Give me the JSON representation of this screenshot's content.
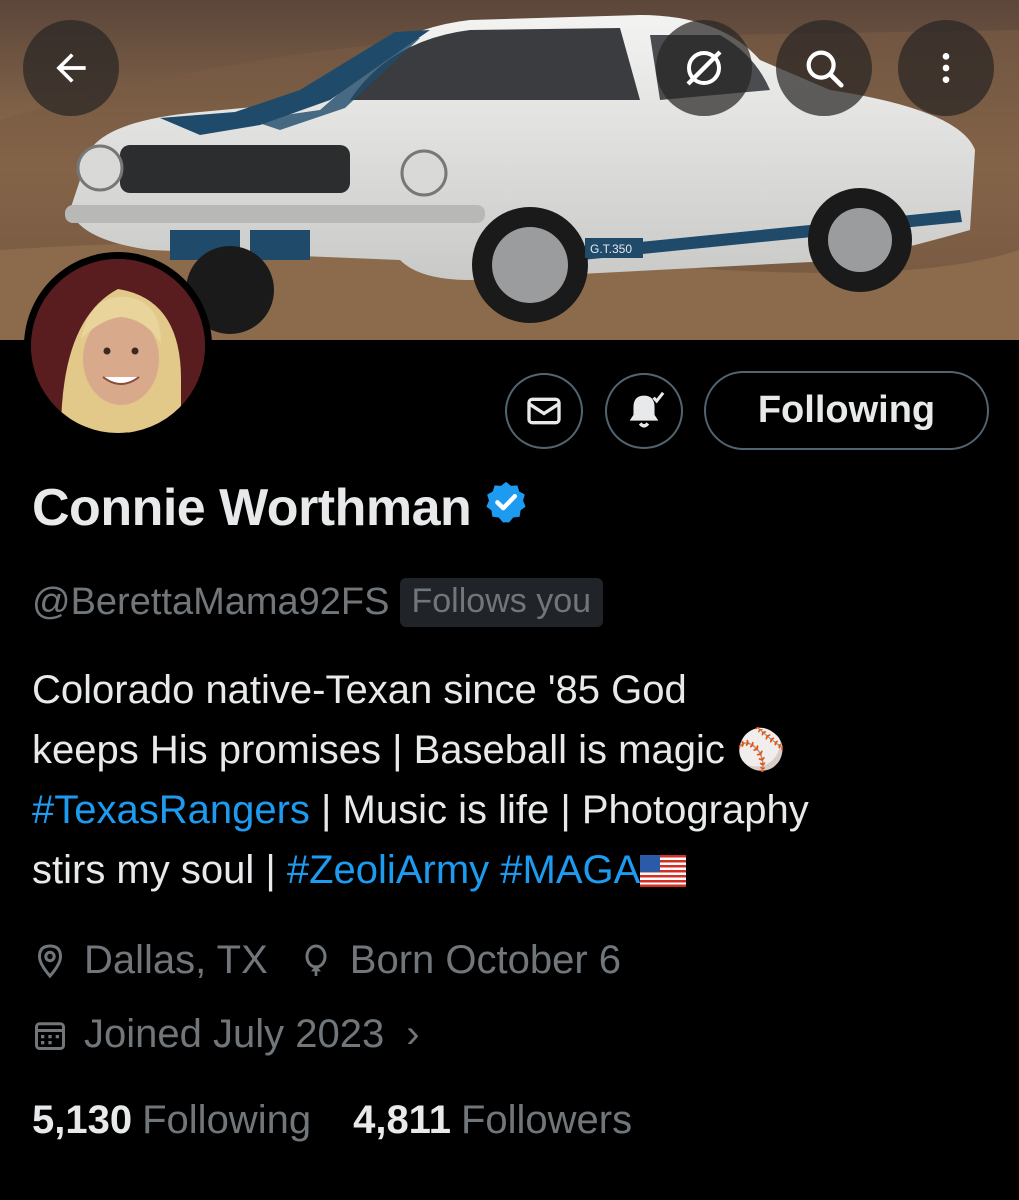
{
  "header": {
    "back_icon": "arrow-left-icon",
    "grok_icon": "grok-icon",
    "search_icon": "search-icon",
    "more_icon": "more-vertical-icon",
    "banner_badge": "G.T.350"
  },
  "actions": {
    "message_icon": "envelope-icon",
    "notify_icon": "bell-check-icon",
    "following_label": "Following"
  },
  "profile": {
    "display_name": "Connie Worthman",
    "verified_icon": "verified-badge-icon",
    "handle": "@BerettaMama92FS",
    "follows_you": "Follows you",
    "bio": {
      "line1": "Colorado native-Texan since '85 God",
      "line2": "keeps His promises | Baseball is magic ",
      "tag_rangers": "#TexasRangers",
      "line3_rest": " | Music is life | Photography",
      "line4_start": "stirs my soul | ",
      "tag_zeoli": "#ZeoliArmy",
      "tag_maga": " #MAGA",
      "baseball_emoji": "⚾"
    },
    "location": "Dallas, TX",
    "birthday": "Born October 6",
    "joined": "Joined July 2023",
    "chevron": "›"
  },
  "stats": {
    "following_count": "5,130",
    "following_label": "Following",
    "followers_count": "4,811",
    "followers_label": "Followers"
  },
  "colors": {
    "accent": "#1d9bf0",
    "text": "#e7e9ea",
    "muted": "#71767b",
    "border": "#536471"
  }
}
